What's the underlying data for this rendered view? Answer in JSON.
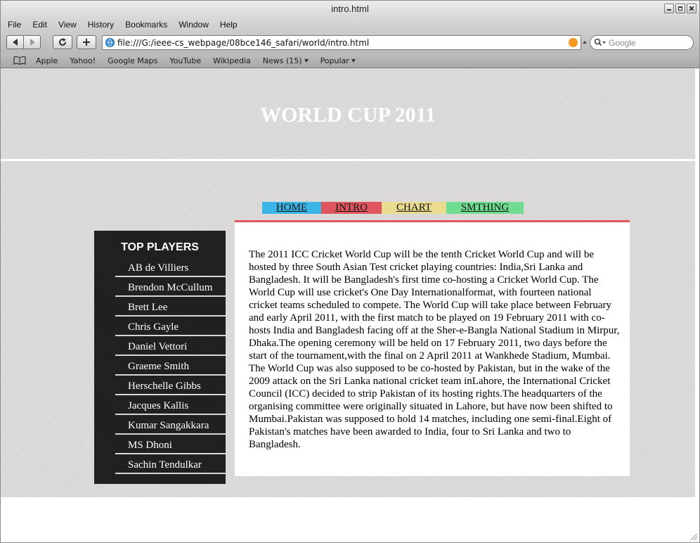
{
  "window": {
    "title": "intro.html"
  },
  "menubar": {
    "items": [
      "File",
      "Edit",
      "View",
      "History",
      "Bookmarks",
      "Window",
      "Help"
    ]
  },
  "toolbar": {
    "url": "file:///G:/ieee-cs_webpage/08bce146_safari/world/intro.html",
    "search_placeholder": "Google"
  },
  "bookmarks": {
    "items": [
      "Apple",
      "Yahoo!",
      "Google Maps",
      "YouTube",
      "Wikipedia",
      "News (15)",
      "Popular"
    ]
  },
  "page": {
    "title": "WORLD CUP 2011",
    "nav": [
      {
        "label": "HOME",
        "color": "#3ab6e6"
      },
      {
        "label": "INTRO",
        "color": "#e0565f"
      },
      {
        "label": "CHART",
        "color": "#eadc8e"
      },
      {
        "label": "SMTHING",
        "color": "#6fdc8f"
      }
    ],
    "sidebar": {
      "title": "TOP PLAYERS",
      "players": [
        "AB de Villiers",
        "Brendon McCullum",
        "Brett Lee",
        "Chris Gayle",
        "Daniel Vettori",
        "Graeme Smith",
        "Herschelle Gibbs",
        "Jacques Kallis",
        "Kumar Sangakkara",
        "MS Dhoni",
        "Sachin Tendulkar"
      ]
    },
    "content": {
      "text": "The 2011 ICC Cricket World Cup will be the tenth Cricket World Cup and will be hosted by three South Asian Test cricket playing countries: India,Sri Lanka and Bangladesh. It will be Bangladesh's first time co-hosting a Cricket World Cup. The World Cup will use cricket's One Day Internationalformat, with fourteen national cricket teams scheduled to compete. The World Cup will take place between February and early April 2011, with the first match to be played on 19 February 2011 with co-hosts India and Bangladesh facing off at the Sher-e-Bangla National Stadium in Mirpur, Dhaka.The opening ceremony will be held on 17 February 2011, two days before the start of the tournament,with the final on 2 April 2011 at Wankhede Stadium, Mumbai. The World Cup was also supposed to be co-hosted by Pakistan, but in the wake of the 2009 attack on the Sri Lanka national cricket team inLahore, the International Cricket Council (ICC) decided to strip Pakistan of its hosting rights.The headquarters of the organising committee were originally situated in Lahore, but have now been shifted to Mumbai.Pakistan was supposed to hold 14 matches, including one semi-final.Eight of Pakistan's matches have been awarded to India, four to Sri Lanka and two to Bangladesh."
    }
  }
}
